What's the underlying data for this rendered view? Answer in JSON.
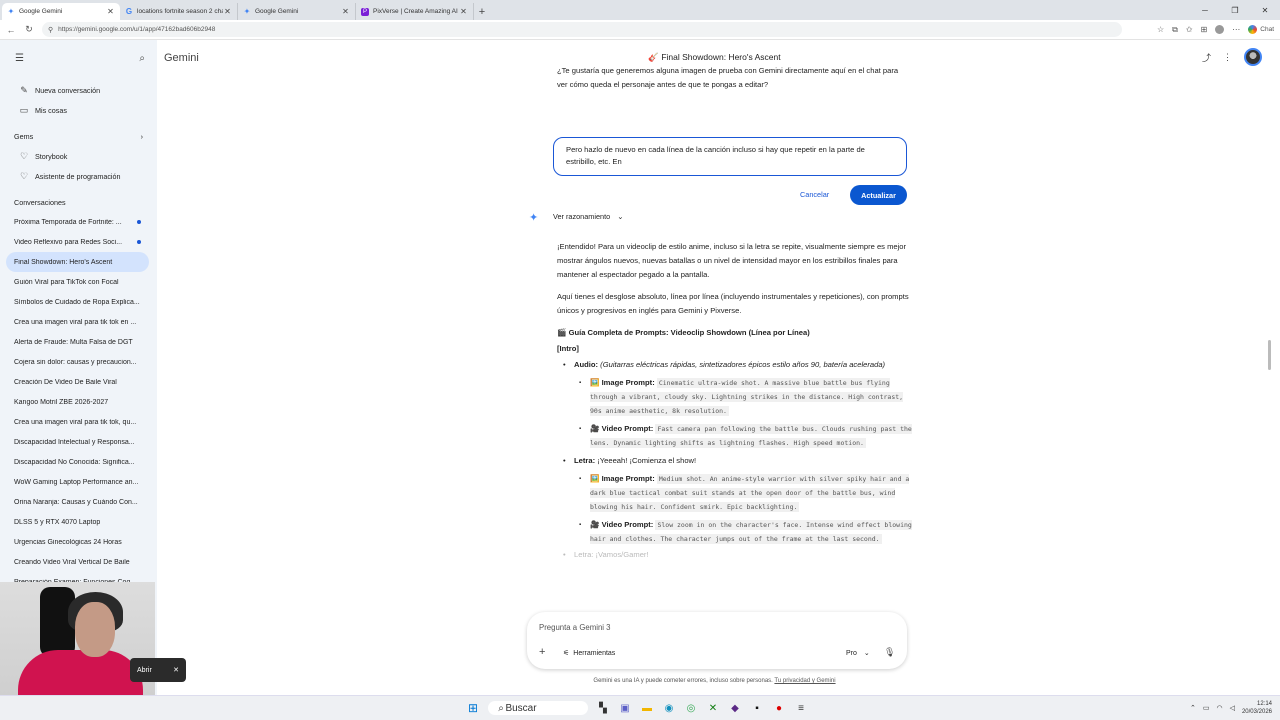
{
  "browser": {
    "tabs": [
      {
        "title": "Google Gemini",
        "icon": "gemini-icon",
        "active": true
      },
      {
        "title": "locations fortnite season 2 chapte",
        "icon": "google-icon",
        "active": false
      },
      {
        "title": "Google Gemini",
        "icon": "gemini-icon",
        "active": false
      },
      {
        "title": "PixVerse | Create Amazing AI Vide",
        "icon": "pixverse-icon",
        "active": false
      }
    ],
    "url": "https://gemini.google.com/u/1/app/47162bad606b2948",
    "chat_label": "Chat"
  },
  "sidebar": {
    "new_chat": "Nueva conversación",
    "my_stuff": "Mis cosas",
    "gems_heading": "Gems",
    "gems": [
      "Storybook",
      "Asistente de programación"
    ],
    "conversations_heading": "Conversaciones",
    "conversations": [
      {
        "title": "Próxima Temporada de Fortnite: ...",
        "dot": true
      },
      {
        "title": "Video Reflexivo para Redes Soci...",
        "dot": true
      },
      {
        "title": "Final Showdown: Hero's Ascent",
        "selected": true
      },
      {
        "title": "Guión Viral para TikTok con Focal"
      },
      {
        "title": "Símbolos de Cuidado de Ropa Explica..."
      },
      {
        "title": "Crea una imagen viral para tik tok en ..."
      },
      {
        "title": "Alerta de Fraude: Multa Falsa de DGT"
      },
      {
        "title": "Cojera sin dolor: causas y precaucion..."
      },
      {
        "title": "Creación De Video De Baile Viral"
      },
      {
        "title": "Kangoo Motril ZBE 2026-2027"
      },
      {
        "title": "Crea una imagen viral para tik tok, qu..."
      },
      {
        "title": "Discapacidad Intelectual y Responsa..."
      },
      {
        "title": "Discapacidad No Conocida: Significa..."
      },
      {
        "title": "WoW Gaming Laptop Performance an..."
      },
      {
        "title": "Orina Naranja: Causas y Cuándo Con..."
      },
      {
        "title": "DLSS 5 y RTX 4070 Laptop"
      },
      {
        "title": "Urgencias Ginecológicas 24 Horas"
      },
      {
        "title": "Creando Video Viral Vertical De Baile"
      },
      {
        "title": "Preparación Examen: Funciones Cog..."
      }
    ],
    "bottom_item": "Ac"
  },
  "header": {
    "app_name": "Gemini",
    "conversation_title": "🎸 Final Showdown: Hero's Ascent"
  },
  "chat": {
    "previous_text": "¿Te gustaría que generemos alguna imagen de prueba con Gemini directamente aquí en el chat para ver cómo queda el personaje antes de que te pongas a editar?",
    "edit_text": "Pero hazlo de nuevo en cada línea de la canción incluso si hay que repetir en la parte de estribillo, etc. En",
    "cancel_label": "Cancelar",
    "update_label": "Actualizar",
    "reasoning_label": "Ver razonamiento",
    "intro_paragraph": "¡Entendido! Para un videoclip de estilo anime, incluso si la letra se repite, visualmente siempre es mejor mostrar ángulos nuevos, nuevas batallas o un nivel de intensidad mayor en los estribillos finales para mantener al espectador pegado a la pantalla.",
    "second_paragraph": "Aquí tienes el desglose absoluto, línea por línea (incluyendo instrumentales y repeticiones), con prompts únicos y progresivos en inglés para Gemini y Pixverse.",
    "guide_title": "🎬 Guía Completa de Prompts: Videoclip Showdown (Línea por Línea)",
    "section_intro": "[Intro]",
    "audio_label": "Audio:",
    "audio_text": "(Guitarras eléctricas rápidas, sintetizadores épicos estilo años 90, batería acelerada)",
    "image_prompt_label": "🖼️ Image Prompt:",
    "video_prompt_label": "🎥 Video Prompt:",
    "audio_image_prompt": "Cinematic ultra-wide shot. A massive blue battle bus flying through a vibrant, cloudy sky. Lightning strikes in the distance. High contrast, 90s anime aesthetic, 8k resolution.",
    "audio_video_prompt": "Fast camera pan following the battle bus. Clouds rushing past the lens. Dynamic lighting shifts as lightning flashes. High speed motion.",
    "letra_label": "Letra:",
    "letra_text": "¡Yeeeah! ¡Comienza el show!",
    "letra_image_prompt": "Medium shot. An anime-style warrior with silver spiky hair and a dark blue tactical combat suit stands at the open door of the battle bus, wind blowing his hair. Confident smirk. Epic backlighting.",
    "letra_video_prompt": "Slow zoom in on the character's face. Intense wind effect blowing hair and clothes. The character jumps out of the frame at the last second.",
    "faded_next": "Letra: ¡Vamos/Gamer!"
  },
  "input": {
    "placeholder": "Pregunta a Gemini 3",
    "tools_label": "Herramientas",
    "model_label": "Pro"
  },
  "disclaimer": {
    "text": "Gemini es una IA y puede cometer errores, incluso sobre personas.",
    "link": "Tu privacidad y Gemini"
  },
  "taskbar": {
    "search_label": "Buscar",
    "time": "12:14",
    "date": "20/03/2026"
  },
  "popup": {
    "label": "Abrir"
  },
  "colors": {
    "accent": "#0b57d0",
    "sidebar_bg": "#f0f4f9",
    "selected_bg": "#d3e3fd"
  }
}
